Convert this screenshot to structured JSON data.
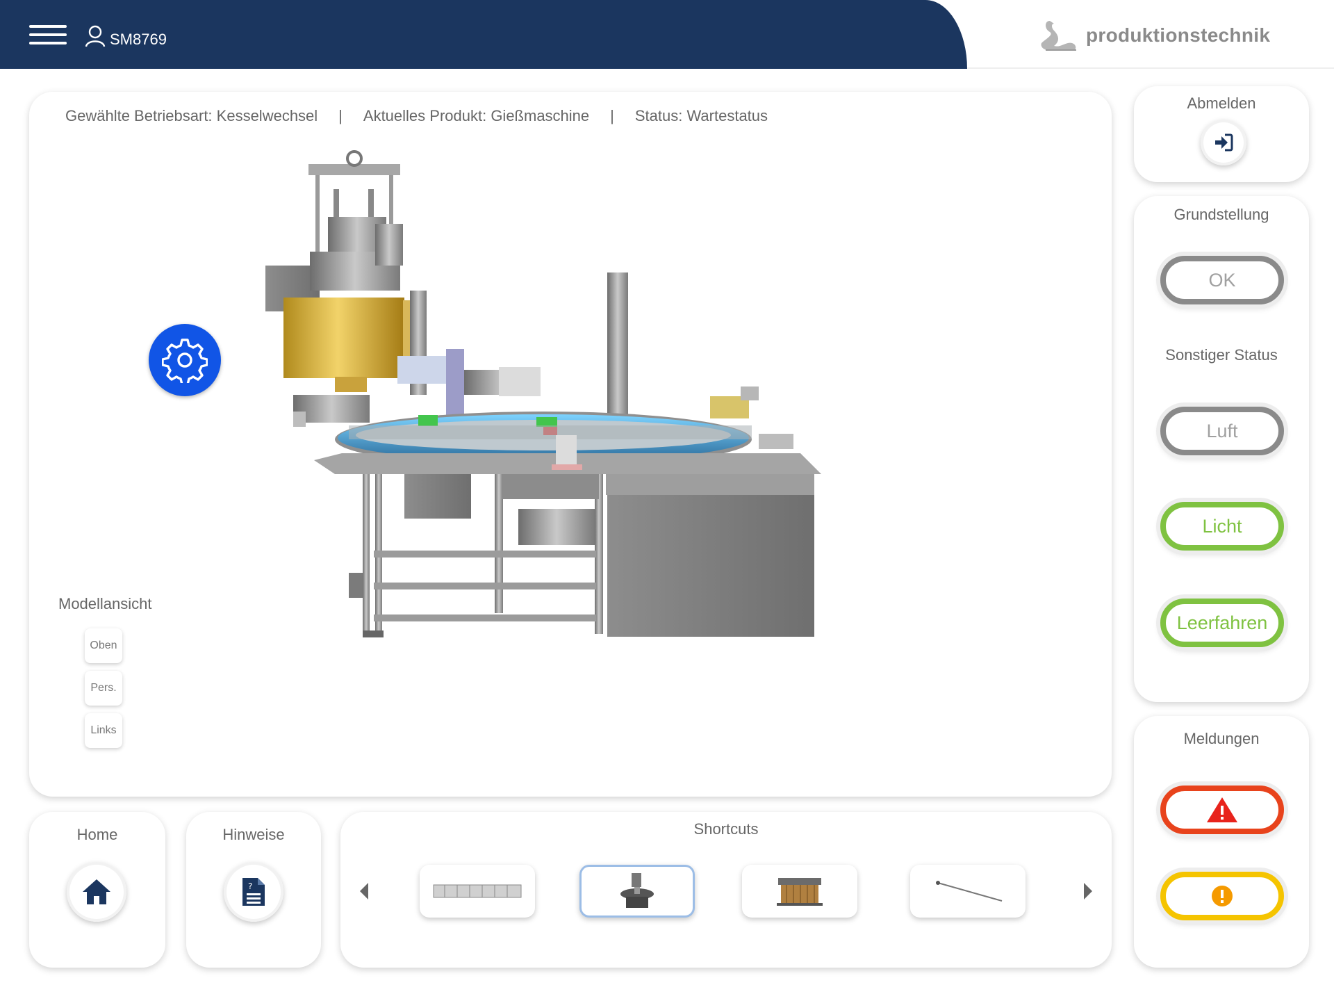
{
  "header": {
    "user": "SM8769",
    "brand": "produktionstechnik",
    "icons": [
      "menu-icon",
      "user-icon",
      "swan-logo"
    ]
  },
  "main": {
    "mode_label": "Gewählte Betriebsart: Kesselwechsel",
    "product_label": "Aktuelles Produkt: Gießmaschine",
    "status_label": "Status: Wartestatus",
    "separator": "|",
    "model_view": {
      "title": "Modellansicht",
      "buttons": [
        "Oben",
        "Pers.",
        "Links"
      ]
    }
  },
  "right": {
    "logout_title": "Abmelden",
    "grundstellung_title": "Grundstellung",
    "ok_label": "OK",
    "other_status_title": "Sonstiger Status",
    "luft_label": "Luft",
    "licht_label": "Licht",
    "leerfahren_label": "Leerfahren",
    "messages_title": "Meldungen"
  },
  "bottom": {
    "home_title": "Home",
    "hints_title": "Hinweise",
    "shortcuts_title": "Shortcuts"
  },
  "colors": {
    "header": "#1b365f",
    "accent_blue": "#1155e6",
    "green": "#7fc241",
    "red": "#e8431c",
    "yellow": "#f5c400",
    "grey": "#8a8a8a"
  }
}
